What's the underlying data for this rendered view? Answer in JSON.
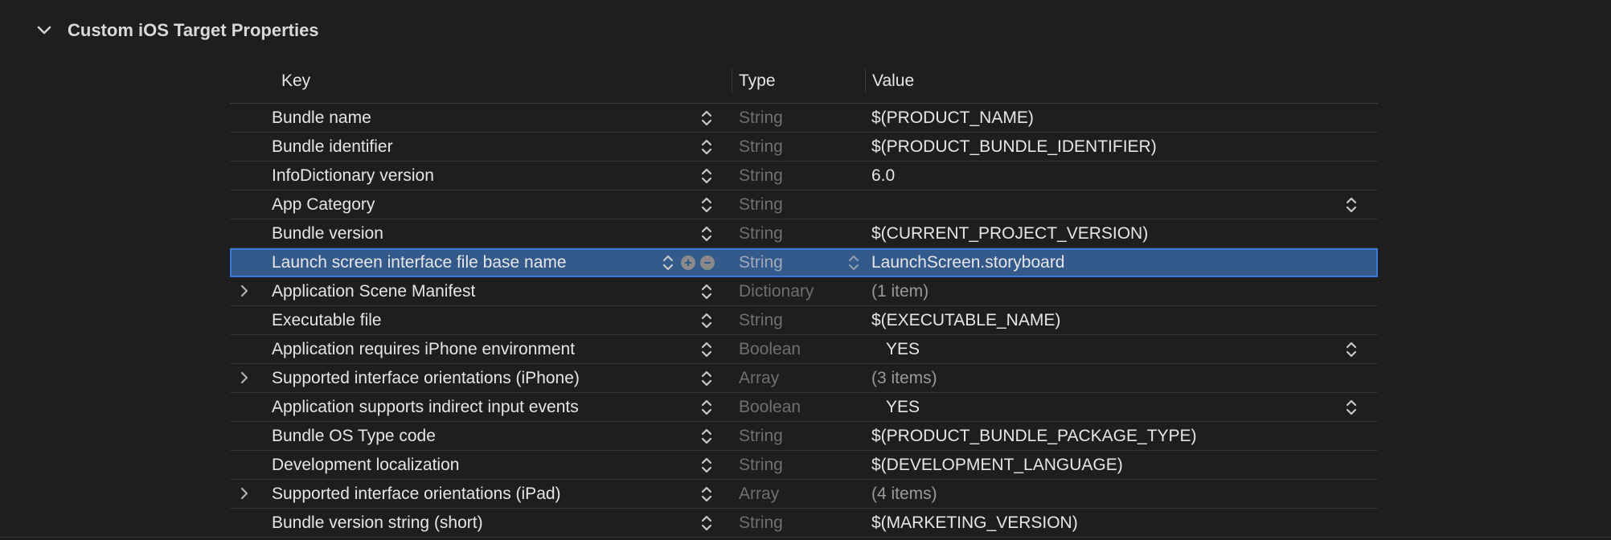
{
  "section": {
    "title": "Custom iOS Target Properties",
    "expanded": true
  },
  "table": {
    "headers": {
      "key": "Key",
      "type": "Type",
      "value": "Value"
    },
    "rows": [
      {
        "key": "Bundle name",
        "type": "String",
        "value": "$(PRODUCT_NAME)",
        "expandable": false,
        "value_popup": false
      },
      {
        "key": "Bundle identifier",
        "type": "String",
        "value": "$(PRODUCT_BUNDLE_IDENTIFIER)",
        "expandable": false,
        "value_popup": false
      },
      {
        "key": "InfoDictionary version",
        "type": "String",
        "value": "6.0",
        "expandable": false,
        "value_popup": false
      },
      {
        "key": "App Category",
        "type": "String",
        "value": "",
        "expandable": false,
        "value_popup": true
      },
      {
        "key": "Bundle version",
        "type": "String",
        "value": "$(CURRENT_PROJECT_VERSION)",
        "expandable": false,
        "value_popup": false
      },
      {
        "key": "Launch screen interface file base name",
        "type": "String",
        "value": "LaunchScreen.storyboard",
        "expandable": false,
        "value_popup": false,
        "selected": true
      },
      {
        "key": "Application Scene Manifest",
        "type": "Dictionary",
        "value": "(1 item)",
        "expandable": true,
        "value_popup": false
      },
      {
        "key": "Executable file",
        "type": "String",
        "value": "$(EXECUTABLE_NAME)",
        "expandable": false,
        "value_popup": false
      },
      {
        "key": "Application requires iPhone environment",
        "type": "Boolean",
        "value": "YES",
        "expandable": false,
        "value_popup": true
      },
      {
        "key": "Supported interface orientations (iPhone)",
        "type": "Array",
        "value": "(3 items)",
        "expandable": true,
        "value_popup": false
      },
      {
        "key": "Application supports indirect input events",
        "type": "Boolean",
        "value": "YES",
        "expandable": false,
        "value_popup": true
      },
      {
        "key": "Bundle OS Type code",
        "type": "String",
        "value": "$(PRODUCT_BUNDLE_PACKAGE_TYPE)",
        "expandable": false,
        "value_popup": false
      },
      {
        "key": "Development localization",
        "type": "String",
        "value": "$(DEVELOPMENT_LANGUAGE)",
        "expandable": false,
        "value_popup": false
      },
      {
        "key": "Supported interface orientations (iPad)",
        "type": "Array",
        "value": "(4 items)",
        "expandable": true,
        "value_popup": false
      },
      {
        "key": "Bundle version string (short)",
        "type": "String",
        "value": "$(MARKETING_VERSION)",
        "expandable": false,
        "value_popup": false
      }
    ]
  },
  "colors": {
    "background": "#1e1e1e",
    "selection": "#345a8c",
    "selection_border": "#3b78d8",
    "muted_text": "#6f6f6f"
  },
  "icons": {
    "section_toggle": "chevron-down-icon",
    "row_disclosure": "chevron-right-icon",
    "stepper": "up-down-stepper-icon",
    "add": "plus-circle-icon",
    "remove": "minus-circle-icon"
  }
}
